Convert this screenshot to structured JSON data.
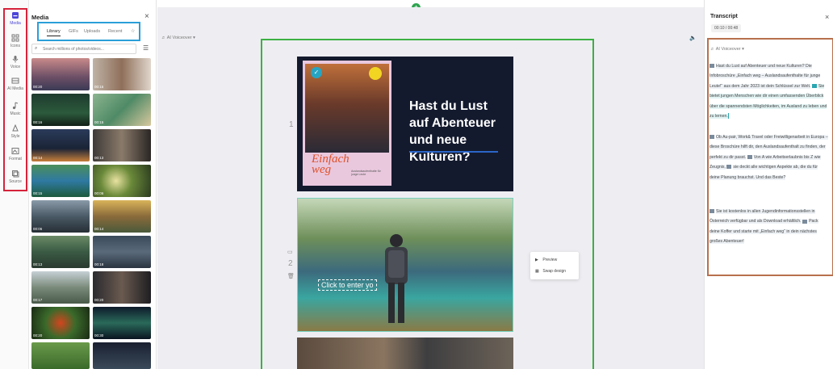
{
  "rail": {
    "items": [
      {
        "label": "Media",
        "icon": "media-icon"
      },
      {
        "label": "Icons",
        "icon": "icons-icon"
      },
      {
        "label": "Voice",
        "icon": "microphone-icon"
      },
      {
        "label": "AI Media",
        "icon": "ai-media-icon"
      },
      {
        "label": "Music",
        "icon": "music-note-icon"
      },
      {
        "label": "Style",
        "icon": "style-icon"
      },
      {
        "label": "Format",
        "icon": "format-icon"
      },
      {
        "label": "Source",
        "icon": "source-icon"
      }
    ]
  },
  "media": {
    "title": "Media",
    "close": "×",
    "tabs": [
      "Library",
      "GIFs",
      "Uploads",
      "Recent"
    ],
    "search_placeholder": "Search millions of photos/videos...",
    "thumbs": [
      {
        "dur": "00:20"
      },
      {
        "dur": "00:15"
      },
      {
        "dur": "00:16"
      },
      {
        "dur": "00:15"
      },
      {
        "dur": "00:14"
      },
      {
        "dur": "00:13"
      },
      {
        "dur": "00:15"
      },
      {
        "dur": "00:06"
      },
      {
        "dur": "00:06"
      },
      {
        "dur": "00:14"
      },
      {
        "dur": "00:13"
      },
      {
        "dur": "00:18"
      },
      {
        "dur": "00:17"
      },
      {
        "dur": "00:20"
      },
      {
        "dur": "00:20"
      },
      {
        "dur": "00:30"
      },
      {
        "dur": ""
      },
      {
        "dur": ""
      }
    ]
  },
  "canvas": {
    "voice_label": "AI Voiceover",
    "scene1_num": "1",
    "scene2_num": "2",
    "slide1_headline": "Hast du Lust auf Abenteuer und neue Kulturen?",
    "book_title_line1": "Einfach",
    "book_title_line2": "weg",
    "book_subtitle": "Auslandsaufenthalte für junge Leute",
    "click_to_enter": "Click to enter yo",
    "context_menu": {
      "preview": "Preview",
      "swap": "Swap design"
    }
  },
  "transcript": {
    "title": "Transcript",
    "close": "×",
    "time": "00:10 / 00:48",
    "voice_label": "AI Voiceover",
    "p1_a": "Hast du Lust auf Abenteuer und neue Kulturen? Die Infobroschüre „Einfach weg – Auslandsaufenthalte für junge Leute!“ aus dem Jahr 2023 ist dein Schlüssel zur Welt.",
    "p1_b": "Sie bietet jungen Menschen wie dir einen umfassenden Überblick über die spannendsten Möglichkeiten, im Ausland zu leben und zu lernen.",
    "p2_a": "Ob Au-pair, Work& Travel oder Freiwilligenarbeit in Europa – diese Broschüre hilft dir, den Auslandsaufenthalt zu finden, der perfekt zu dir passt.",
    "p2_b": "Von A wie Arbeitserlaubnis bis Z wie Zeugnis,",
    "p2_c": "sie deckt alle wichtigen Aspekte ab, die du für deine Planung brauchst. Und das Beste?",
    "p3_a": "Sie ist kostenlos in allen Jugendinformationsstellen in Österreich verfügbar und als Download erhältlich.",
    "p3_b": "Pack deine Koffer und starte mit „Einfach weg“ in dein nächstes großes Abenteuer!"
  }
}
